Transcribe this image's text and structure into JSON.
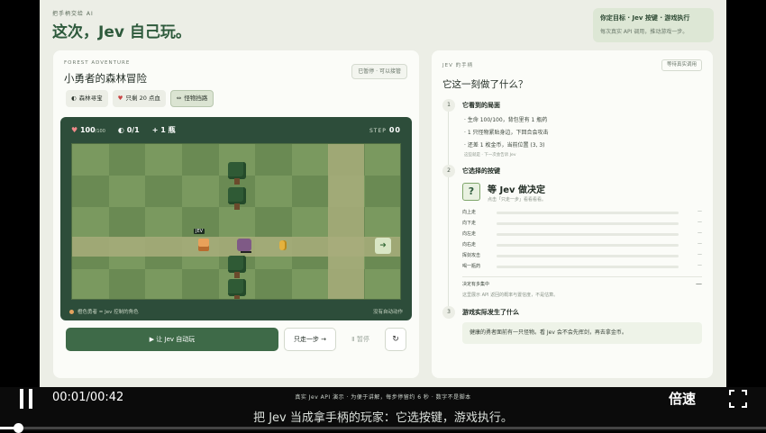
{
  "header": {
    "kicker": "把手柄交给 AI",
    "title": "这次，Jev 自己玩。",
    "goal_title": "你定目标 · Jev 按键 · 游戏执行",
    "goal_sub": "每次真实 API 调用，推动游戏一步。"
  },
  "game_panel": {
    "kicker": "FOREST ADVENTURE",
    "title": "小勇者的森林冒险",
    "status_badge": "已暂停 · 可以接管",
    "chips": [
      {
        "icon": "◐",
        "label": "森林寻宝"
      },
      {
        "icon": "♥",
        "label": "只剩 20 点血"
      },
      {
        "icon": "⇔",
        "label": "怪物挡路"
      }
    ],
    "hud": {
      "hp": "100",
      "hp_max": "/100",
      "coins": "0/1",
      "potions": "1 瓶",
      "step_label": "STEP",
      "step_value": "00"
    },
    "hero_tag": "JEV",
    "legend": "橙色勇者 = Jev 控制的角色",
    "no_auto": "没有自动动作",
    "buttons": {
      "auto": "▶ 让 Jev 自动玩",
      "step": "只走一步 →",
      "pause": "Ⅱ 暂停",
      "reset": "↻"
    }
  },
  "reasoning_panel": {
    "kicker": "JEV 的手柄",
    "badge": "等待真实调用",
    "title": "它这一刻做了什么？",
    "sections": [
      {
        "num": "1",
        "title": "它看到的局面",
        "bullets": [
          "· 生命 100/100，背包里有 1 瓶药",
          "· 1 只怪物紧贴身边，下回合会攻击",
          "· 还差 1 枚金币，当前位置 (3, 3)"
        ],
        "note": "这些就是 · 下一次会告诉 Jev"
      },
      {
        "num": "2",
        "title": "它选择的按键",
        "decision_icon": "?",
        "decision_title": "等 Jev 做决定",
        "decision_sub": "点击「只走一步」看看看看。",
        "options": [
          {
            "label": "向上走",
            "value": "—"
          },
          {
            "label": "向下走",
            "value": "—"
          },
          {
            "label": "向左走",
            "value": "—"
          },
          {
            "label": "向右走",
            "value": "—"
          },
          {
            "label": "挥剑攻击",
            "value": "—"
          },
          {
            "label": "喝一瓶药",
            "value": "—"
          }
        ],
        "concentration_label": "决定有多集中",
        "concentration_value": "—",
        "concentration_note": "这里展示 API 返回的概率与置信度，不是估算。"
      },
      {
        "num": "3",
        "title": "游戏实际发生了什么",
        "result": "健康的勇者面前有一只怪物。看 Jev 会不会先挥剑，再去拿金币。"
      }
    ]
  },
  "player": {
    "time": "00:01/00:42",
    "note": "真实 Jev API 演示 · 为便于讲解，每步停留约 6 秒 · 数字不是脚本",
    "speed": "倍速",
    "subtitle": "把 Jev 当成拿手柄的玩家：它选按键，游戏执行。",
    "progress": 0.024
  }
}
